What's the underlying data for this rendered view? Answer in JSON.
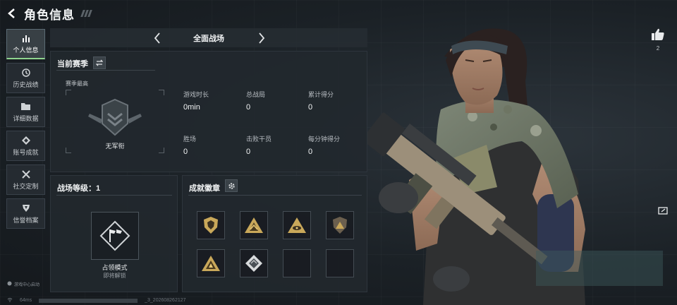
{
  "header": {
    "title": "角色信息"
  },
  "sidebar": {
    "items": [
      {
        "label": "个人信息",
        "icon": "bar-chart-icon",
        "active": true
      },
      {
        "label": "历史战绩",
        "icon": "history-icon"
      },
      {
        "label": "详细数据",
        "icon": "folder-icon"
      },
      {
        "label": "账号成就",
        "icon": "achievement-icon"
      },
      {
        "label": "社交定制",
        "icon": "tools-icon"
      },
      {
        "label": "信誉档案",
        "icon": "shield-icon"
      }
    ],
    "footer": "游戏中心启动"
  },
  "mode_bar": {
    "label": "全面战场"
  },
  "season_panel": {
    "title": "当前赛季",
    "best_label": "赛季最高",
    "rank_name": "无军衔",
    "stats": [
      {
        "key": "游戏时长",
        "value": "0min"
      },
      {
        "key": "总战局",
        "value": "0"
      },
      {
        "key": "累计得分",
        "value": "0"
      },
      {
        "key": "胜场",
        "value": "0"
      },
      {
        "key": "击败干员",
        "value": "0"
      },
      {
        "key": "每分钟得分",
        "value": "0"
      }
    ]
  },
  "level_panel": {
    "title": "战场等级：1",
    "mode_name": "占领模式",
    "mode_sub": "即将解锁"
  },
  "badge_panel": {
    "title": "成就徽章",
    "badges": [
      {
        "icon": "badge-shield-icon",
        "filled": true
      },
      {
        "icon": "badge-mountain-icon",
        "filled": true
      },
      {
        "icon": "badge-eye-icon",
        "filled": true
      },
      {
        "icon": "badge-dark-triangle-icon",
        "filled": true
      },
      {
        "icon": "badge-gold-triangle-icon",
        "filled": true
      },
      {
        "icon": "badge-diamond-icon",
        "filled": true
      },
      {
        "icon": "",
        "filled": false
      },
      {
        "icon": "",
        "filled": false
      }
    ]
  },
  "likes": {
    "count": "2"
  },
  "status_bar": {
    "ping": "64ms",
    "uid": "_3_202608262127"
  },
  "colors": {
    "accent_green": "#8fd48e",
    "gold": "#c9a85a",
    "panel": "#22282e"
  }
}
